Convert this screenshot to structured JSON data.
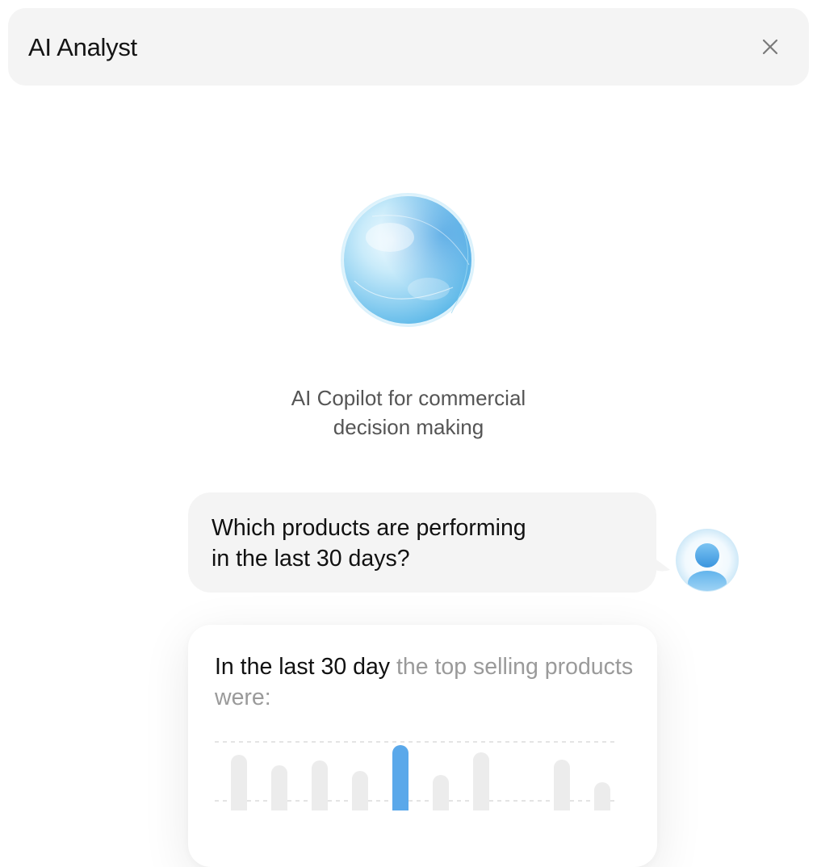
{
  "header": {
    "title": "AI Analyst",
    "close_icon": "close-icon"
  },
  "hero": {
    "orb_icon": "ai-orb-icon",
    "tagline_line1": "AI Copilot for commercial",
    "tagline_line2": "decision making"
  },
  "user_message": {
    "line1": "Which products are performing",
    "line2": "in the last 30 days?",
    "avatar_icon": "user-avatar-icon"
  },
  "answer": {
    "lead": "In the last 30 day",
    "rest": " the top selling products were:"
  },
  "colors": {
    "accent": "#5aa8ea",
    "muted_bar": "#ececec",
    "bubble_bg": "#f4f4f4"
  },
  "chart_data": {
    "type": "bar",
    "categories": [],
    "values": [
      0.81,
      0.68,
      0.74,
      0.61,
      0.93,
      0.56,
      0.84,
      0.12,
      0.75,
      0.47
    ],
    "highlight_index": 4,
    "ylim": [
      0,
      1
    ],
    "grid": true
  }
}
